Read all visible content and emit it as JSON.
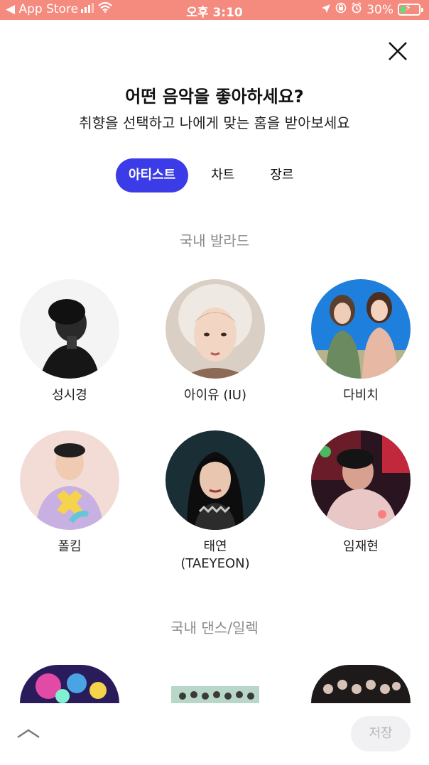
{
  "status_bar": {
    "back_label": "◀ App Store",
    "time": "오후 3:10",
    "battery": "30%",
    "battery_level": 0.3
  },
  "header": {
    "title": "어떤 음악을 좋아하세요?",
    "subtitle": "취향을 선택하고 나에게 맞는 홈을 받아보세요"
  },
  "tabs": [
    {
      "label": "아티스트",
      "active": true
    },
    {
      "label": "차트",
      "active": false
    },
    {
      "label": "장르",
      "active": false
    }
  ],
  "sections": [
    {
      "title": "국내 발라드",
      "artists": [
        {
          "name": "성시경"
        },
        {
          "name": "아이유 (IU)"
        },
        {
          "name": "다비치"
        },
        {
          "name": "폴킴"
        },
        {
          "name": "태연\n(TAEYEON)"
        },
        {
          "name": "임재현"
        }
      ]
    },
    {
      "title": "국내 댄스/일렉",
      "artists": []
    }
  ],
  "footer": {
    "save_label": "저장"
  },
  "colors": {
    "accent": "#3b3ce8",
    "status_bar": "#f58a7e"
  }
}
